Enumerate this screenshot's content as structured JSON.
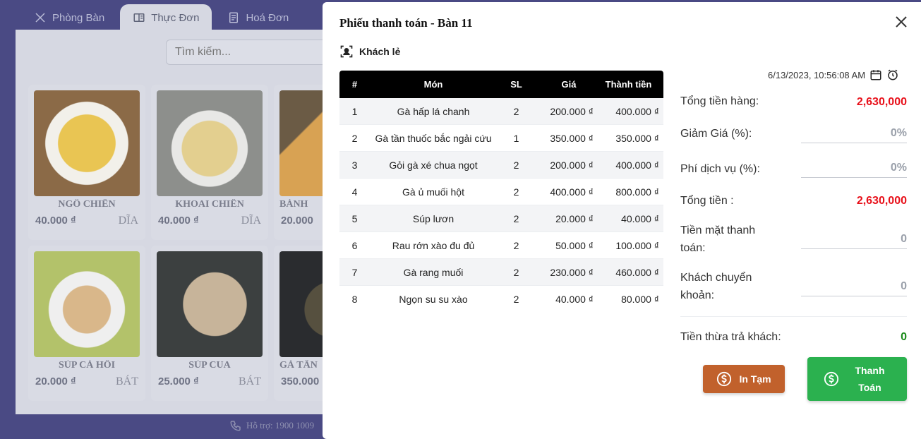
{
  "app": {
    "tabs": [
      {
        "label": "Phòng Bàn",
        "icon": "fork-knife-icon"
      },
      {
        "label": "Thực Đơn",
        "icon": "menu-book-icon"
      },
      {
        "label": "Hoá Đơn",
        "icon": "receipt-icon"
      }
    ],
    "search_placeholder": "Tìm kiếm...",
    "menu_items": [
      {
        "name": "NGÔ CHIÊN",
        "price": "40.000 ₫",
        "unit": "DĨA"
      },
      {
        "name": "KHOAI CHIÊN",
        "price": "40.000 ₫",
        "unit": "DĨA"
      },
      {
        "name": "BÁNH",
        "price": "20.000",
        "unit": ""
      },
      {
        "name": "SÚP CÁ HỒI",
        "price": "20.000 ₫",
        "unit": "BÁT"
      },
      {
        "name": "SÚP CUA",
        "price": "25.000 ₫",
        "unit": "BÁT"
      },
      {
        "name": "GÀ TẦN",
        "price": "350.000",
        "unit": ""
      }
    ],
    "support": "Hỗ trợ: 1900 1009"
  },
  "modal": {
    "title": "Phiếu thanh toán - Bàn 11",
    "customer": "Khách lẻ",
    "datetime": "6/13/2023, 10:56:08 AM",
    "table": {
      "headers": [
        "#",
        "Món",
        "SL",
        "Giá",
        "Thành tiền"
      ],
      "rows": [
        [
          "1",
          "Gà hấp lá chanh",
          "2",
          "200.000 ₫",
          "400.000 ₫"
        ],
        [
          "2",
          "Gà tần thuốc bắc ngải cứu",
          "1",
          "350.000 ₫",
          "350.000 ₫"
        ],
        [
          "3",
          "Gỏi gà xé chua ngọt",
          "2",
          "200.000 ₫",
          "400.000 ₫"
        ],
        [
          "4",
          "Gà ủ muối hột",
          "2",
          "400.000 ₫",
          "800.000 ₫"
        ],
        [
          "5",
          "Súp lươn",
          "2",
          "20.000 ₫",
          "40.000 ₫"
        ],
        [
          "6",
          "Rau rớn xào đu đủ",
          "2",
          "50.000 ₫",
          "100.000 ₫"
        ],
        [
          "7",
          "Gà rang muối",
          "2",
          "230.000 ₫",
          "460.000 ₫"
        ],
        [
          "8",
          "Ngọn su su xào",
          "2",
          "40.000 ₫",
          "80.000 ₫"
        ]
      ]
    },
    "summary": {
      "subtotal_label": "Tổng tiền hàng:",
      "subtotal_value": "2,630,000",
      "discount_label": "Giảm Giá (%):",
      "discount_value": "0%",
      "service_label": "Phí dịch vụ (%):",
      "service_value": "0%",
      "total_label": "Tổng tiền :",
      "total_value": "2,630,000",
      "cash_label_1": "Tiền mặt thanh",
      "cash_label_2": "toán:",
      "cash_value": "0",
      "transfer_label_1": "Khách chuyển",
      "transfer_label_2": "khoản:",
      "transfer_value": "0",
      "change_label": "Tiền thừa trả khách:",
      "change_value": "0"
    },
    "buttons": {
      "print": "In Tạm",
      "pay_line1": "Thanh",
      "pay_line2": "Toán"
    },
    "colors": {
      "print": "#c1612c",
      "pay": "#2bb14f",
      "amount": "#e8101a",
      "change": "#1a8a1a"
    }
  }
}
